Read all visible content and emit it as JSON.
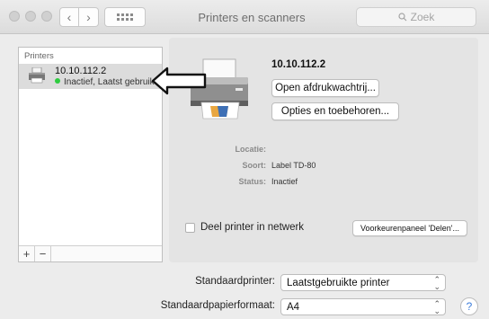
{
  "window": {
    "title": "Printers en scanners",
    "back_glyph": "‹",
    "forward_glyph": "›",
    "search_placeholder": "Zoek",
    "search_icon": "magnifier-icon"
  },
  "sidebar": {
    "header": "Printers",
    "printers": [
      {
        "name": "10.10.112.2",
        "status": "Inactief, Laatst gebruikt",
        "status_color": "#2ecc40"
      }
    ],
    "add_label": "+",
    "remove_label": "−"
  },
  "detail": {
    "name": "10.10.112.2",
    "open_queue_label": "Open afdrukwachtrij...",
    "options_label": "Opties en toebehoren...",
    "location_label": "Locatie:",
    "location_value": "",
    "kind_label": "Soort:",
    "kind_value": "Label TD-80",
    "status_label": "Status:",
    "status_value": "Inactief",
    "share_label": "Deel printer in netwerk",
    "share_checked": false,
    "sharing_prefs_label": "Voorkeurenpaneel 'Delen'..."
  },
  "defaults": {
    "printer_label": "Standaardprinter:",
    "printer_value": "Laatstgebruikte printer",
    "paper_label": "Standaardpapierformaat:",
    "paper_value": "A4"
  },
  "help_label": "?",
  "colors": {
    "accent": "#3d7ddb",
    "selection": "#dcdcdc",
    "status_green": "#2ecc40"
  }
}
